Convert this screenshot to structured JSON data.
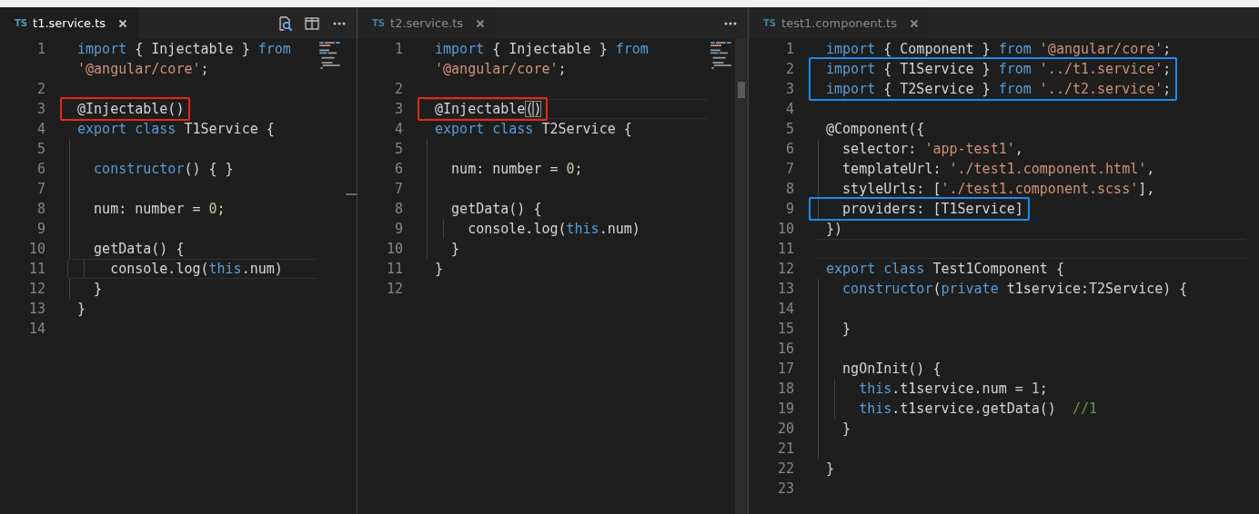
{
  "panes": [
    {
      "tab": {
        "badge": "TS",
        "title": "t1.service.ts",
        "focused": true
      },
      "actions": [
        {
          "kind": "preview"
        },
        {
          "kind": "split"
        },
        {
          "kind": "more"
        }
      ],
      "minimap": true,
      "rows": [
        {
          "number": "1",
          "tokens": [
            {
              "kind": "keyword",
              "text": "import"
            },
            {
              "kind": "plain",
              "text": " { Injectable } "
            },
            {
              "kind": "keyword",
              "text": "from"
            }
          ]
        },
        {
          "tokens": [
            {
              "kind": "string",
              "text": "'@angular/core'"
            },
            {
              "kind": "plain",
              "text": ";"
            }
          ]
        },
        {
          "number": "2"
        },
        {
          "number": "3",
          "color": "#e8271b",
          "tokens": [
            {
              "kind": "plain",
              "text": "@Injectable()"
            }
          ]
        },
        {
          "number": "4",
          "tokens": [
            {
              "kind": "keyword",
              "text": "export class"
            },
            {
              "kind": "plain",
              "text": " T1Service {"
            }
          ]
        },
        {
          "number": "5"
        },
        {
          "number": "6",
          "tokens": [
            {
              "kind": "keyword",
              "text": "  constructor"
            },
            {
              "kind": "plain",
              "text": "() { }"
            }
          ]
        },
        {
          "number": "7"
        },
        {
          "number": "8",
          "tokens": [
            {
              "kind": "plain",
              "text": "  num: number = "
            },
            {
              "kind": "number",
              "text": "0"
            },
            {
              "kind": "plain",
              "text": ";"
            }
          ]
        },
        {
          "number": "9"
        },
        {
          "number": "10",
          "tokens": [
            {
              "kind": "plain",
              "text": "  getData() {"
            }
          ]
        },
        {
          "number": "11",
          "current": true,
          "tokens": [
            {
              "kind": "plain",
              "text": "    console.log("
            },
            {
              "kind": "keyword",
              "text": "this"
            },
            {
              "kind": "plain",
              "text": ".num)"
            }
          ]
        },
        {
          "number": "12",
          "tokens": [
            {
              "kind": "plain",
              "text": "  }"
            }
          ]
        },
        {
          "number": "13",
          "tokens": [
            {
              "kind": "plain",
              "text": "}"
            }
          ]
        },
        {
          "number": "14"
        }
      ]
    },
    {
      "tab": {
        "badge": "TS",
        "title": "t2.service.ts",
        "focused": false
      },
      "actions": [
        {
          "kind": "more"
        }
      ],
      "minimap": true,
      "rows": [
        {
          "number": "1",
          "tokens": [
            {
              "kind": "keyword",
              "text": "import"
            },
            {
              "kind": "plain",
              "text": " { Injectable } "
            },
            {
              "kind": "keyword",
              "text": "from"
            }
          ]
        },
        {
          "tokens": [
            {
              "kind": "string",
              "text": "'@angular/core'"
            },
            {
              "kind": "plain",
              "text": ";"
            }
          ]
        },
        {
          "number": "2"
        },
        {
          "number": "3",
          "color": "#e8271b",
          "current": true,
          "tokens": [
            {
              "kind": "plain",
              "text": "@Injectable"
            },
            {
              "kind": "match",
              "text": "("
            },
            {
              "kind": "match",
              "text": ")"
            }
          ]
        },
        {
          "number": "4",
          "tokens": [
            {
              "kind": "keyword",
              "text": "export class"
            },
            {
              "kind": "plain",
              "text": " T2Service {"
            }
          ]
        },
        {
          "number": "5"
        },
        {
          "number": "6",
          "tokens": [
            {
              "kind": "plain",
              "text": "  num: number = "
            },
            {
              "kind": "number",
              "text": "0"
            },
            {
              "kind": "plain",
              "text": ";"
            }
          ]
        },
        {
          "number": "7"
        },
        {
          "number": "8",
          "tokens": [
            {
              "kind": "plain",
              "text": "  getData() {"
            }
          ]
        },
        {
          "number": "9",
          "tokens": [
            {
              "kind": "plain",
              "text": "    console.log("
            },
            {
              "kind": "keyword",
              "text": "this"
            },
            {
              "kind": "plain",
              "text": ".num)"
            }
          ]
        },
        {
          "number": "10",
          "tokens": [
            {
              "kind": "plain",
              "text": "  }"
            }
          ]
        },
        {
          "number": "11",
          "tokens": [
            {
              "kind": "plain",
              "text": "}"
            }
          ]
        },
        {
          "number": "12"
        }
      ]
    },
    {
      "tab": {
        "badge": "TS",
        "title": "test1.component.ts",
        "focused": false
      },
      "rows": [
        {
          "number": "1",
          "tokens": [
            {
              "kind": "keyword",
              "text": "import"
            },
            {
              "kind": "plain",
              "text": " { Component } "
            },
            {
              "kind": "keyword",
              "text": "from "
            },
            {
              "kind": "string",
              "text": "'@angular/core'"
            },
            {
              "kind": "plain",
              "text": ";"
            }
          ]
        },
        {
          "number": "2",
          "color": "#1a8cf0",
          "tokens": [
            {
              "kind": "keyword",
              "text": "import"
            },
            {
              "kind": "plain",
              "text": " { T1Service } "
            },
            {
              "kind": "keyword",
              "text": "from "
            },
            {
              "kind": "string",
              "text": "'../t1.service'"
            },
            {
              "kind": "plain",
              "text": ";"
            }
          ]
        },
        {
          "number": "3",
          "color": "#1a8cf0",
          "tokens": [
            {
              "kind": "keyword",
              "text": "import"
            },
            {
              "kind": "plain",
              "text": " { T2Service } "
            },
            {
              "kind": "keyword",
              "text": "from "
            },
            {
              "kind": "string",
              "text": "'../t2.service'"
            },
            {
              "kind": "plain",
              "text": ";"
            }
          ]
        },
        {
          "number": "4"
        },
        {
          "number": "5",
          "tokens": [
            {
              "kind": "plain",
              "text": "@Component({"
            }
          ]
        },
        {
          "number": "6",
          "tokens": [
            {
              "kind": "plain",
              "text": "  selector: "
            },
            {
              "kind": "string",
              "text": "'app-test1'"
            },
            {
              "kind": "plain",
              "text": ","
            }
          ]
        },
        {
          "number": "7",
          "tokens": [
            {
              "kind": "plain",
              "text": "  templateUrl: "
            },
            {
              "kind": "string",
              "text": "'./test1.component.html'"
            },
            {
              "kind": "plain",
              "text": ","
            }
          ]
        },
        {
          "number": "8",
          "tokens": [
            {
              "kind": "plain",
              "text": "  styleUrls: ["
            },
            {
              "kind": "string",
              "text": "'./test1.component.scss'"
            },
            {
              "kind": "plain",
              "text": "],"
            }
          ]
        },
        {
          "number": "9",
          "color": "#1a8cf0",
          "tokens": [
            {
              "kind": "plain",
              "text": "  providers: [T1Service]"
            }
          ]
        },
        {
          "number": "10",
          "tokens": [
            {
              "kind": "plain",
              "text": "})"
            }
          ]
        },
        {
          "number": "11",
          "current": true
        },
        {
          "number": "12",
          "tokens": [
            {
              "kind": "keyword",
              "text": "export class"
            },
            {
              "kind": "plain",
              "text": " Test1Component {"
            }
          ]
        },
        {
          "number": "13",
          "tokens": [
            {
              "kind": "keyword",
              "text": "  constructor"
            },
            {
              "kind": "plain",
              "text": "("
            },
            {
              "kind": "keyword",
              "text": "private"
            },
            {
              "kind": "plain",
              "text": " t1service:T2Service) {"
            }
          ]
        },
        {
          "number": "14"
        },
        {
          "number": "15",
          "tokens": [
            {
              "kind": "plain",
              "text": "  }"
            }
          ]
        },
        {
          "number": "16"
        },
        {
          "number": "17",
          "tokens": [
            {
              "kind": "plain",
              "text": "  ngOnInit() {"
            }
          ]
        },
        {
          "number": "18",
          "tokens": [
            {
              "kind": "keyword",
              "text": "    this"
            },
            {
              "kind": "plain",
              "text": ".t1service.num = "
            },
            {
              "kind": "number",
              "text": "1"
            },
            {
              "kind": "plain",
              "text": ";"
            }
          ]
        },
        {
          "number": "19",
          "tokens": [
            {
              "kind": "keyword",
              "text": "    this"
            },
            {
              "kind": "plain",
              "text": ".t1service.getData()  "
            },
            {
              "kind": "comment",
              "text": "//1"
            }
          ]
        },
        {
          "number": "20",
          "tokens": [
            {
              "kind": "plain",
              "text": "  }"
            }
          ]
        },
        {
          "number": "21"
        },
        {
          "number": "22",
          "tokens": [
            {
              "kind": "plain",
              "text": "}"
            }
          ]
        },
        {
          "number": "23"
        }
      ]
    }
  ]
}
